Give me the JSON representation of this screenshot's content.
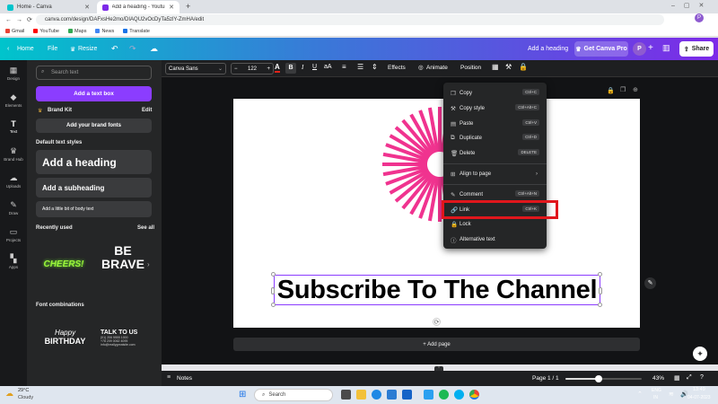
{
  "browser": {
    "tabs": [
      {
        "label": "Home - Canva"
      },
      {
        "label": "Add a heading - Youtube Banner"
      }
    ],
    "url": "canva.com/design/DAFxsHe2mo/DIAQU2vOcDyTa5zlY-ZmHA/edit",
    "bookmarks": [
      "Gmail",
      "YouTube",
      "Maps",
      "News",
      "Translate"
    ]
  },
  "header": {
    "home": "Home",
    "file": "File",
    "resize": "Resize",
    "doc_title": "Add a heading",
    "get_pro": "Get Canva Pro",
    "avatar": "P",
    "share": "Share"
  },
  "rail": {
    "items": [
      {
        "label": "Design",
        "icon": "design-icon"
      },
      {
        "label": "Elements",
        "icon": "elements-icon"
      },
      {
        "label": "Text",
        "icon": "text-icon"
      },
      {
        "label": "Brand Hub",
        "icon": "brand-icon"
      },
      {
        "label": "Uploads",
        "icon": "uploads-icon"
      },
      {
        "label": "Draw",
        "icon": "draw-icon"
      },
      {
        "label": "Projects",
        "icon": "projects-icon"
      },
      {
        "label": "Apps",
        "icon": "apps-icon"
      }
    ]
  },
  "panel": {
    "search_placeholder": "Search text",
    "add_text_box": "Add a text box",
    "brand_kit": "Brand Kit",
    "brand_edit": "Edit",
    "add_brand_fonts": "Add your brand fonts",
    "default_styles": "Default text styles",
    "heading": "Add a heading",
    "subheading": "Add a subheading",
    "body": "Add a little bit of body text",
    "recently_used": "Recently used",
    "see_all": "See all",
    "recent_1": "CHEERS!",
    "recent_2a": "BE",
    "recent_2b": "BRAVE",
    "font_combinations": "Font combinations",
    "combo_1a": "Happy",
    "combo_1b": "BIRTHDAY",
    "combo_2a": "TALK TO US",
    "combo_2b": "(01) 206 5555 1000",
    "combo_2c": "+78 209 0062 4095",
    "combo_2d": "info@reallygreatsite.com"
  },
  "toolbar": {
    "font": "Canva Sans",
    "minus": "−",
    "size": "122",
    "plus": "+",
    "effects": "Effects",
    "animate": "Animate",
    "position": "Position"
  },
  "canvas": {
    "headline": "Subscribe To The Channel",
    "add_page": "+ Add page"
  },
  "context_menu": {
    "items": [
      {
        "label": "Copy",
        "shortcut": "Ctrl+C"
      },
      {
        "label": "Copy style",
        "shortcut": "Ctrl+Alt+C"
      },
      {
        "label": "Paste",
        "shortcut": "Ctrl+V"
      },
      {
        "label": "Duplicate",
        "shortcut": "Ctrl+D"
      },
      {
        "label": "Delete",
        "shortcut": "DELETE"
      },
      {
        "label": "Align to page",
        "shortcut": ""
      },
      {
        "label": "Comment",
        "shortcut": "Ctrl+Alt+N"
      },
      {
        "label": "Link",
        "shortcut": "Ctrl+K"
      },
      {
        "label": "Lock",
        "shortcut": ""
      },
      {
        "label": "Alternative text",
        "shortcut": ""
      }
    ]
  },
  "bottom": {
    "notes": "Notes",
    "page": "Page 1 / 1",
    "zoom": "43%",
    "zoom_fraction": 0.43
  },
  "taskbar": {
    "weather_temp": "29°C",
    "weather_desc": "Cloudy",
    "search": "Search",
    "lang_1": "ENG",
    "lang_2": "IN",
    "time": "13:49",
    "date": "04-07-2023"
  },
  "colors": {
    "accent": "#8b3dff",
    "highlight_box": "#e0161c",
    "sunburst": "#f0338f"
  }
}
